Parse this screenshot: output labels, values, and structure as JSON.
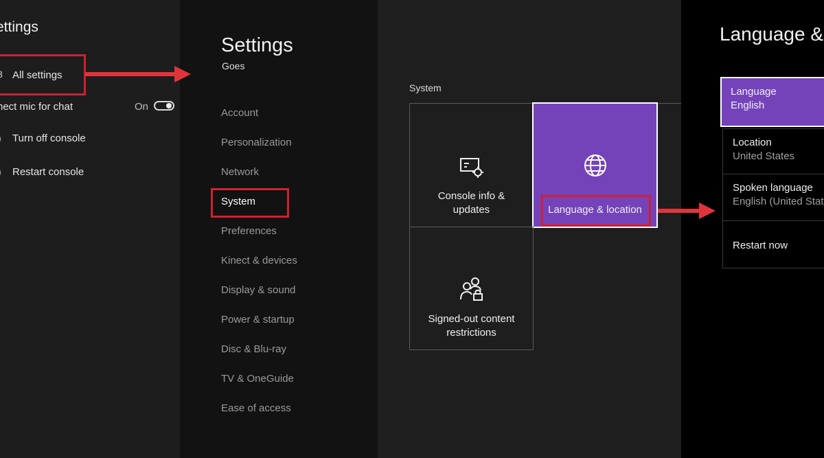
{
  "guide_panel": {
    "title": "ettings",
    "items": [
      {
        "icon": "settings-icon",
        "glyph": "8",
        "label": "All settings"
      },
      {
        "label": "nect mic for chat",
        "value": "On"
      },
      {
        "icon": "power-icon",
        "glyph": ")",
        "label": "Turn off console"
      },
      {
        "icon": "restart-icon",
        "glyph": ")",
        "label": "Restart console"
      }
    ]
  },
  "settings_panel": {
    "title": "Settings",
    "subtitle": "Goes",
    "nav": [
      "Account",
      "Personalization",
      "Network",
      "System",
      "Preferences",
      "Kinect & devices",
      "Display & sound",
      "Power & startup",
      "Disc & Blu-ray",
      "TV & OneGuide",
      "Ease of access"
    ],
    "selected": "System"
  },
  "system_panel": {
    "section": "System",
    "tiles": [
      {
        "icon": "console-info-icon",
        "label": "Console info &\nupdates"
      },
      {
        "icon": "globe-icon",
        "label": "Language & location"
      },
      {
        "icon": "people-lock-icon",
        "label": "Signed-out content\nrestrictions"
      }
    ]
  },
  "language_panel": {
    "title": "Language &",
    "options": [
      {
        "label": "Language",
        "value": "English"
      },
      {
        "label": "Location",
        "value": "United States"
      },
      {
        "label": "Spoken language",
        "value": "English (United State"
      },
      {
        "label": "Restart now"
      }
    ]
  },
  "colors": {
    "accent": "#7443ba",
    "annotation": "#d2202f"
  }
}
